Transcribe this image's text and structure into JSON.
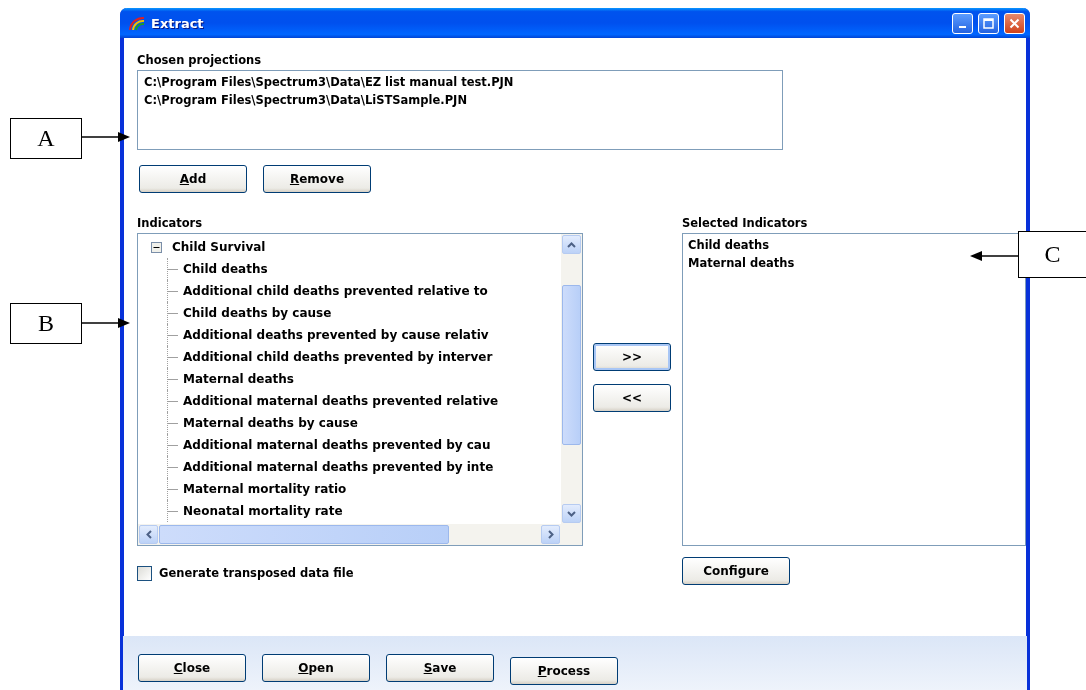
{
  "annotations": [
    {
      "label": "A"
    },
    {
      "label": "B"
    },
    {
      "label": "C"
    }
  ],
  "window": {
    "title": "Extract"
  },
  "projections": {
    "label": "Chosen projections",
    "items": [
      "C:\\Program Files\\Spectrum3\\Data\\EZ list manual test.PJN",
      "C:\\Program Files\\Spectrum3\\Data\\LiSTSample.PJN"
    ]
  },
  "projection_buttons": [
    {
      "label": "Add",
      "mnemonic": true
    },
    {
      "label": "Remove",
      "mnemonic": true
    }
  ],
  "indicators": {
    "label": "Indicators",
    "tree": [
      {
        "label": "Child Survival",
        "expanded": true,
        "children": [
          {
            "label": "Child deaths"
          },
          {
            "label": "Additional child deaths prevented relative to"
          },
          {
            "label": "Child deaths by cause"
          },
          {
            "label": "Additional deaths prevented by cause relativ"
          },
          {
            "label": "Additional child deaths prevented by interver"
          },
          {
            "label": "Maternal deaths"
          },
          {
            "label": "Additional maternal deaths prevented relative"
          },
          {
            "label": "Maternal deaths by cause"
          },
          {
            "label": "Additional maternal deaths prevented by cau"
          },
          {
            "label": "Additional maternal deaths prevented by inte"
          },
          {
            "label": "Maternal mortality ratio"
          },
          {
            "label": "Neonatal mortality rate"
          }
        ]
      }
    ]
  },
  "move_buttons": [
    ">>",
    "<<"
  ],
  "selected_indicators": {
    "label": "Selected Indicators",
    "items": [
      "Child deaths",
      "Maternal deaths"
    ]
  },
  "configure_button": {
    "label": "Configure"
  },
  "transpose_checkbox": {
    "label": "Generate transposed data file",
    "checked": false
  },
  "footer_buttons": [
    {
      "label": "Close",
      "mnemonic": true
    },
    {
      "label": "Open",
      "mnemonic": true
    },
    {
      "label": "Save",
      "mnemonic": true
    },
    {
      "label": "Process",
      "mnemonic": true
    }
  ]
}
